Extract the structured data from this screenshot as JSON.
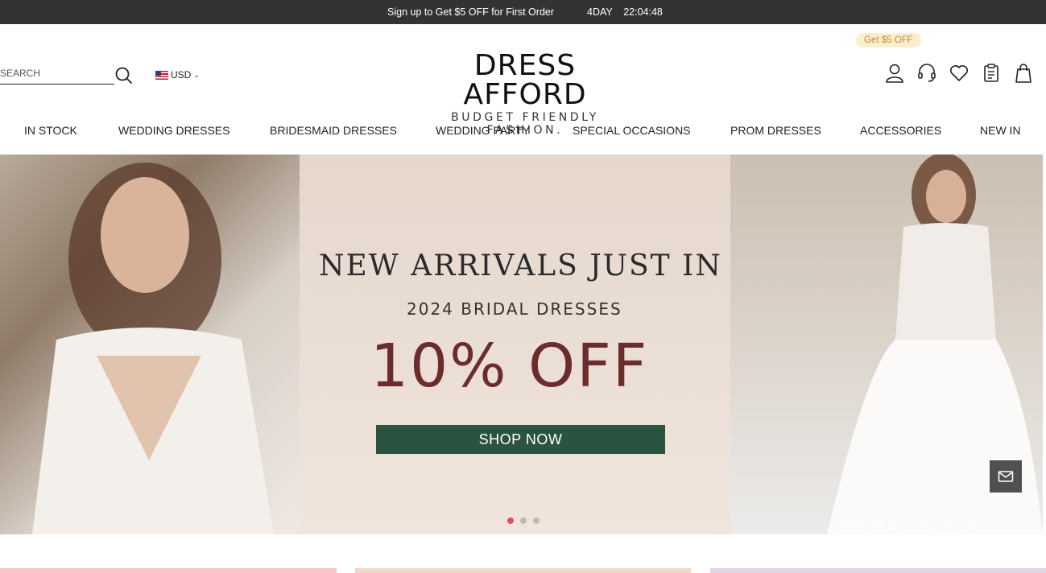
{
  "topbar": {
    "promo": "Sign up to Get $5 OFF for First Order",
    "days": "4DAY",
    "clock": "22:04:48"
  },
  "header": {
    "search_placeholder": "SEARCH",
    "currency": "USD",
    "logo_brand": "DRESS AFFORD",
    "logo_tagline": "BUDGET FRIENDLY FASHION.",
    "coupon_badge": "Get $5 OFF",
    "icons": [
      "user-icon",
      "support-headset-icon",
      "heart-icon",
      "orders-icon",
      "shopping-bag-icon"
    ]
  },
  "nav": {
    "items": [
      "IN STOCK",
      "WEDDING DRESSES",
      "BRIDESMAID DRESSES",
      "WEDDING PARTY",
      "SPECIAL OCCASIONS",
      "PROM DRESSES",
      "ACCESSORIES",
      "NEW IN"
    ]
  },
  "hero": {
    "title": "NEW ARRIVALS JUST IN",
    "subtitle": "2024 BRIDAL DRESSES",
    "discount": "10% OFF",
    "cta": "SHOP NOW",
    "watermark": "COMPLAINTS",
    "slides": 3,
    "active_slide": 1
  },
  "colors": {
    "topbar": "#333333",
    "coupon_bg": "#fbeecf",
    "coupon_text": "#c78a2d",
    "cta_bg": "#2b5440",
    "discount_text": "#6b2c2c",
    "active_dot": "#e4505d"
  }
}
